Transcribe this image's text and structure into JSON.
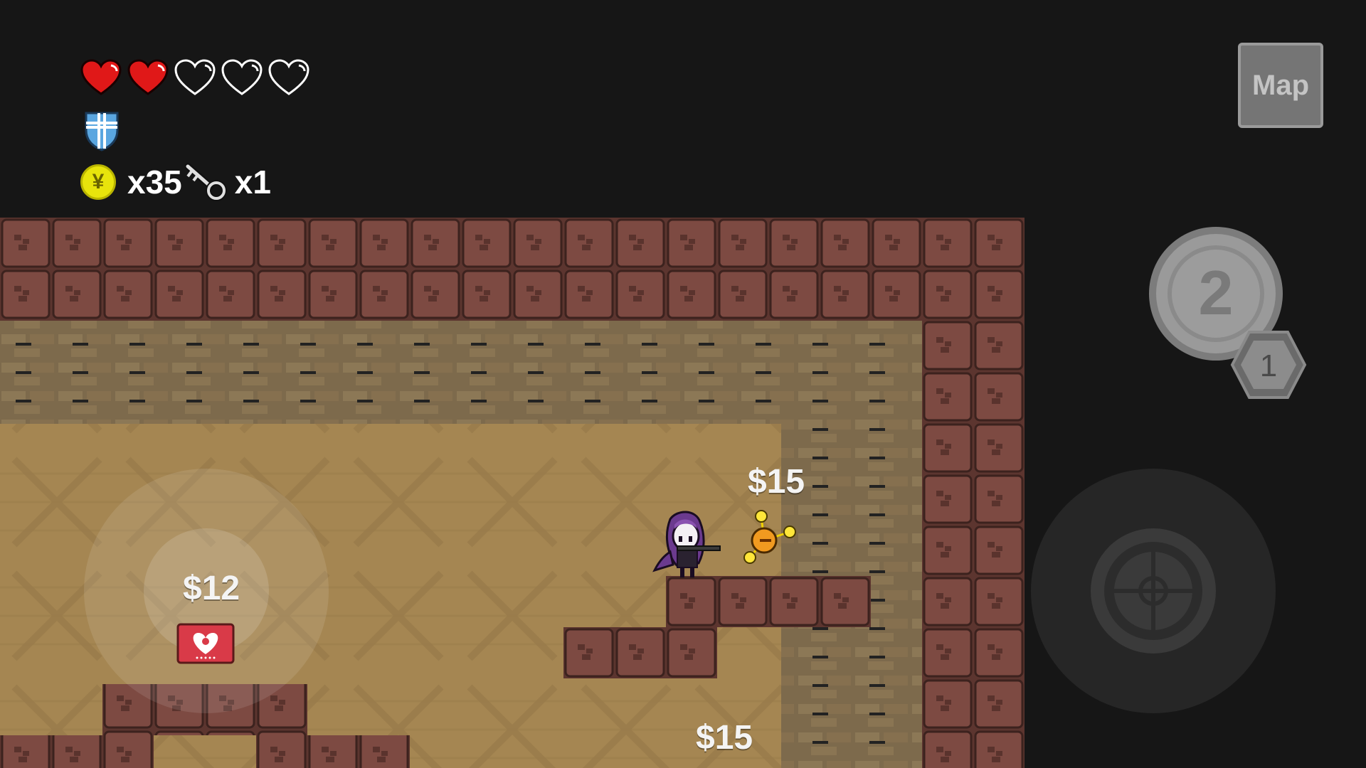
{
  "hud": {
    "hearts": {
      "full": 2,
      "total": 5
    },
    "armor_icon": "shield-cross-icon",
    "coins": "x35",
    "keys": "x1",
    "coin_symbol": "¥"
  },
  "map_button": {
    "label": "Map"
  },
  "skill": {
    "level": "2",
    "charges": "1"
  },
  "shop": {
    "items": [
      {
        "price": "$12",
        "item": "heart-container"
      },
      {
        "price": "$15",
        "item": "orb-pet"
      },
      {
        "price": "$15",
        "item": "unknown"
      }
    ]
  },
  "colors": {
    "background": "#161616",
    "floor": "#a58652",
    "brick": "#7d4a42",
    "heart": "#e01818"
  }
}
